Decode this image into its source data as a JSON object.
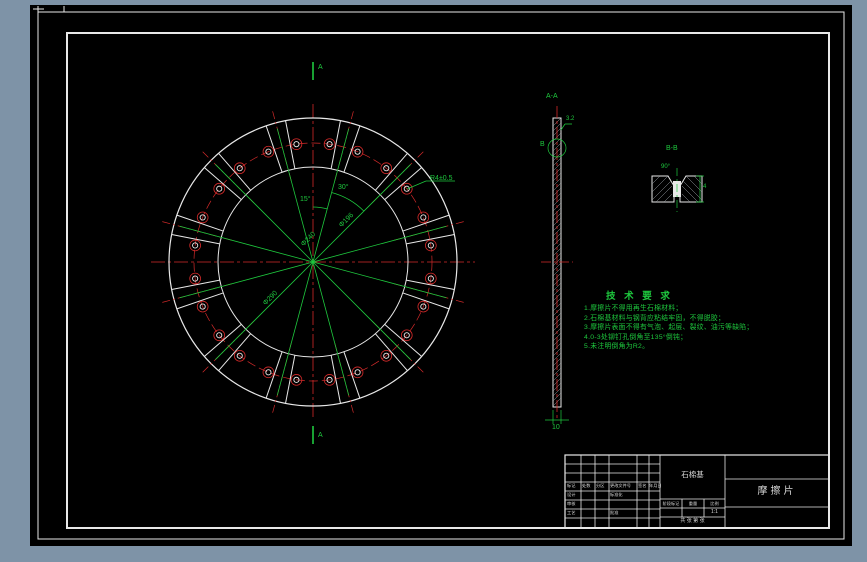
{
  "colors": {
    "background": "#7e93a7",
    "paper": "#000000",
    "line_white": "#e8e8e8",
    "line_red": "#d42a2a",
    "line_green": "#1ec93e"
  },
  "front_view": {
    "angle_dim_small": "15°",
    "angle_dim_large": "30°",
    "dia_inner": "Φ196",
    "dia_bolt": "Φ240",
    "dia_outer": "Φ290",
    "hole_note": "R4±0.5",
    "section_letter_top": "A",
    "section_letter_bottom": "A"
  },
  "side_view": {
    "title": "A-A",
    "detail_callout": "B",
    "thickness": "10",
    "roughness": "3.2"
  },
  "detail_view": {
    "title": "B-B",
    "countersink_angle": "90°",
    "depth": "4"
  },
  "tech_req": {
    "title": "技 术 要 求",
    "items": [
      "1.摩擦片不得用再生石棉材料；",
      "2.石棉基材料与钢背应粘结牢固，不得脱胶；",
      "3.摩擦片表面不得有气泡、起层、裂纹、油污等缺陷；",
      "4.0-3处铆钉孔倒角至135°倒钝；",
      "5.未注明倒角为R2。"
    ]
  },
  "title_block": {
    "material": "石棉基",
    "part_name": "摩擦片",
    "col_mark": "标记",
    "col_count": "处数",
    "col_zone": "分区",
    "col_doc": "更改文件号",
    "col_sign": "签名",
    "col_date": "年月日",
    "row_design": "设计",
    "row_standard": "标准化",
    "row_check": "审核",
    "row_process": "工艺",
    "row_approve": "批准",
    "stage_mark": "阶段标记",
    "weight": "重量",
    "scale": "比例",
    "scale_value": "1:1",
    "sheet_info": "共 张 第 张"
  }
}
